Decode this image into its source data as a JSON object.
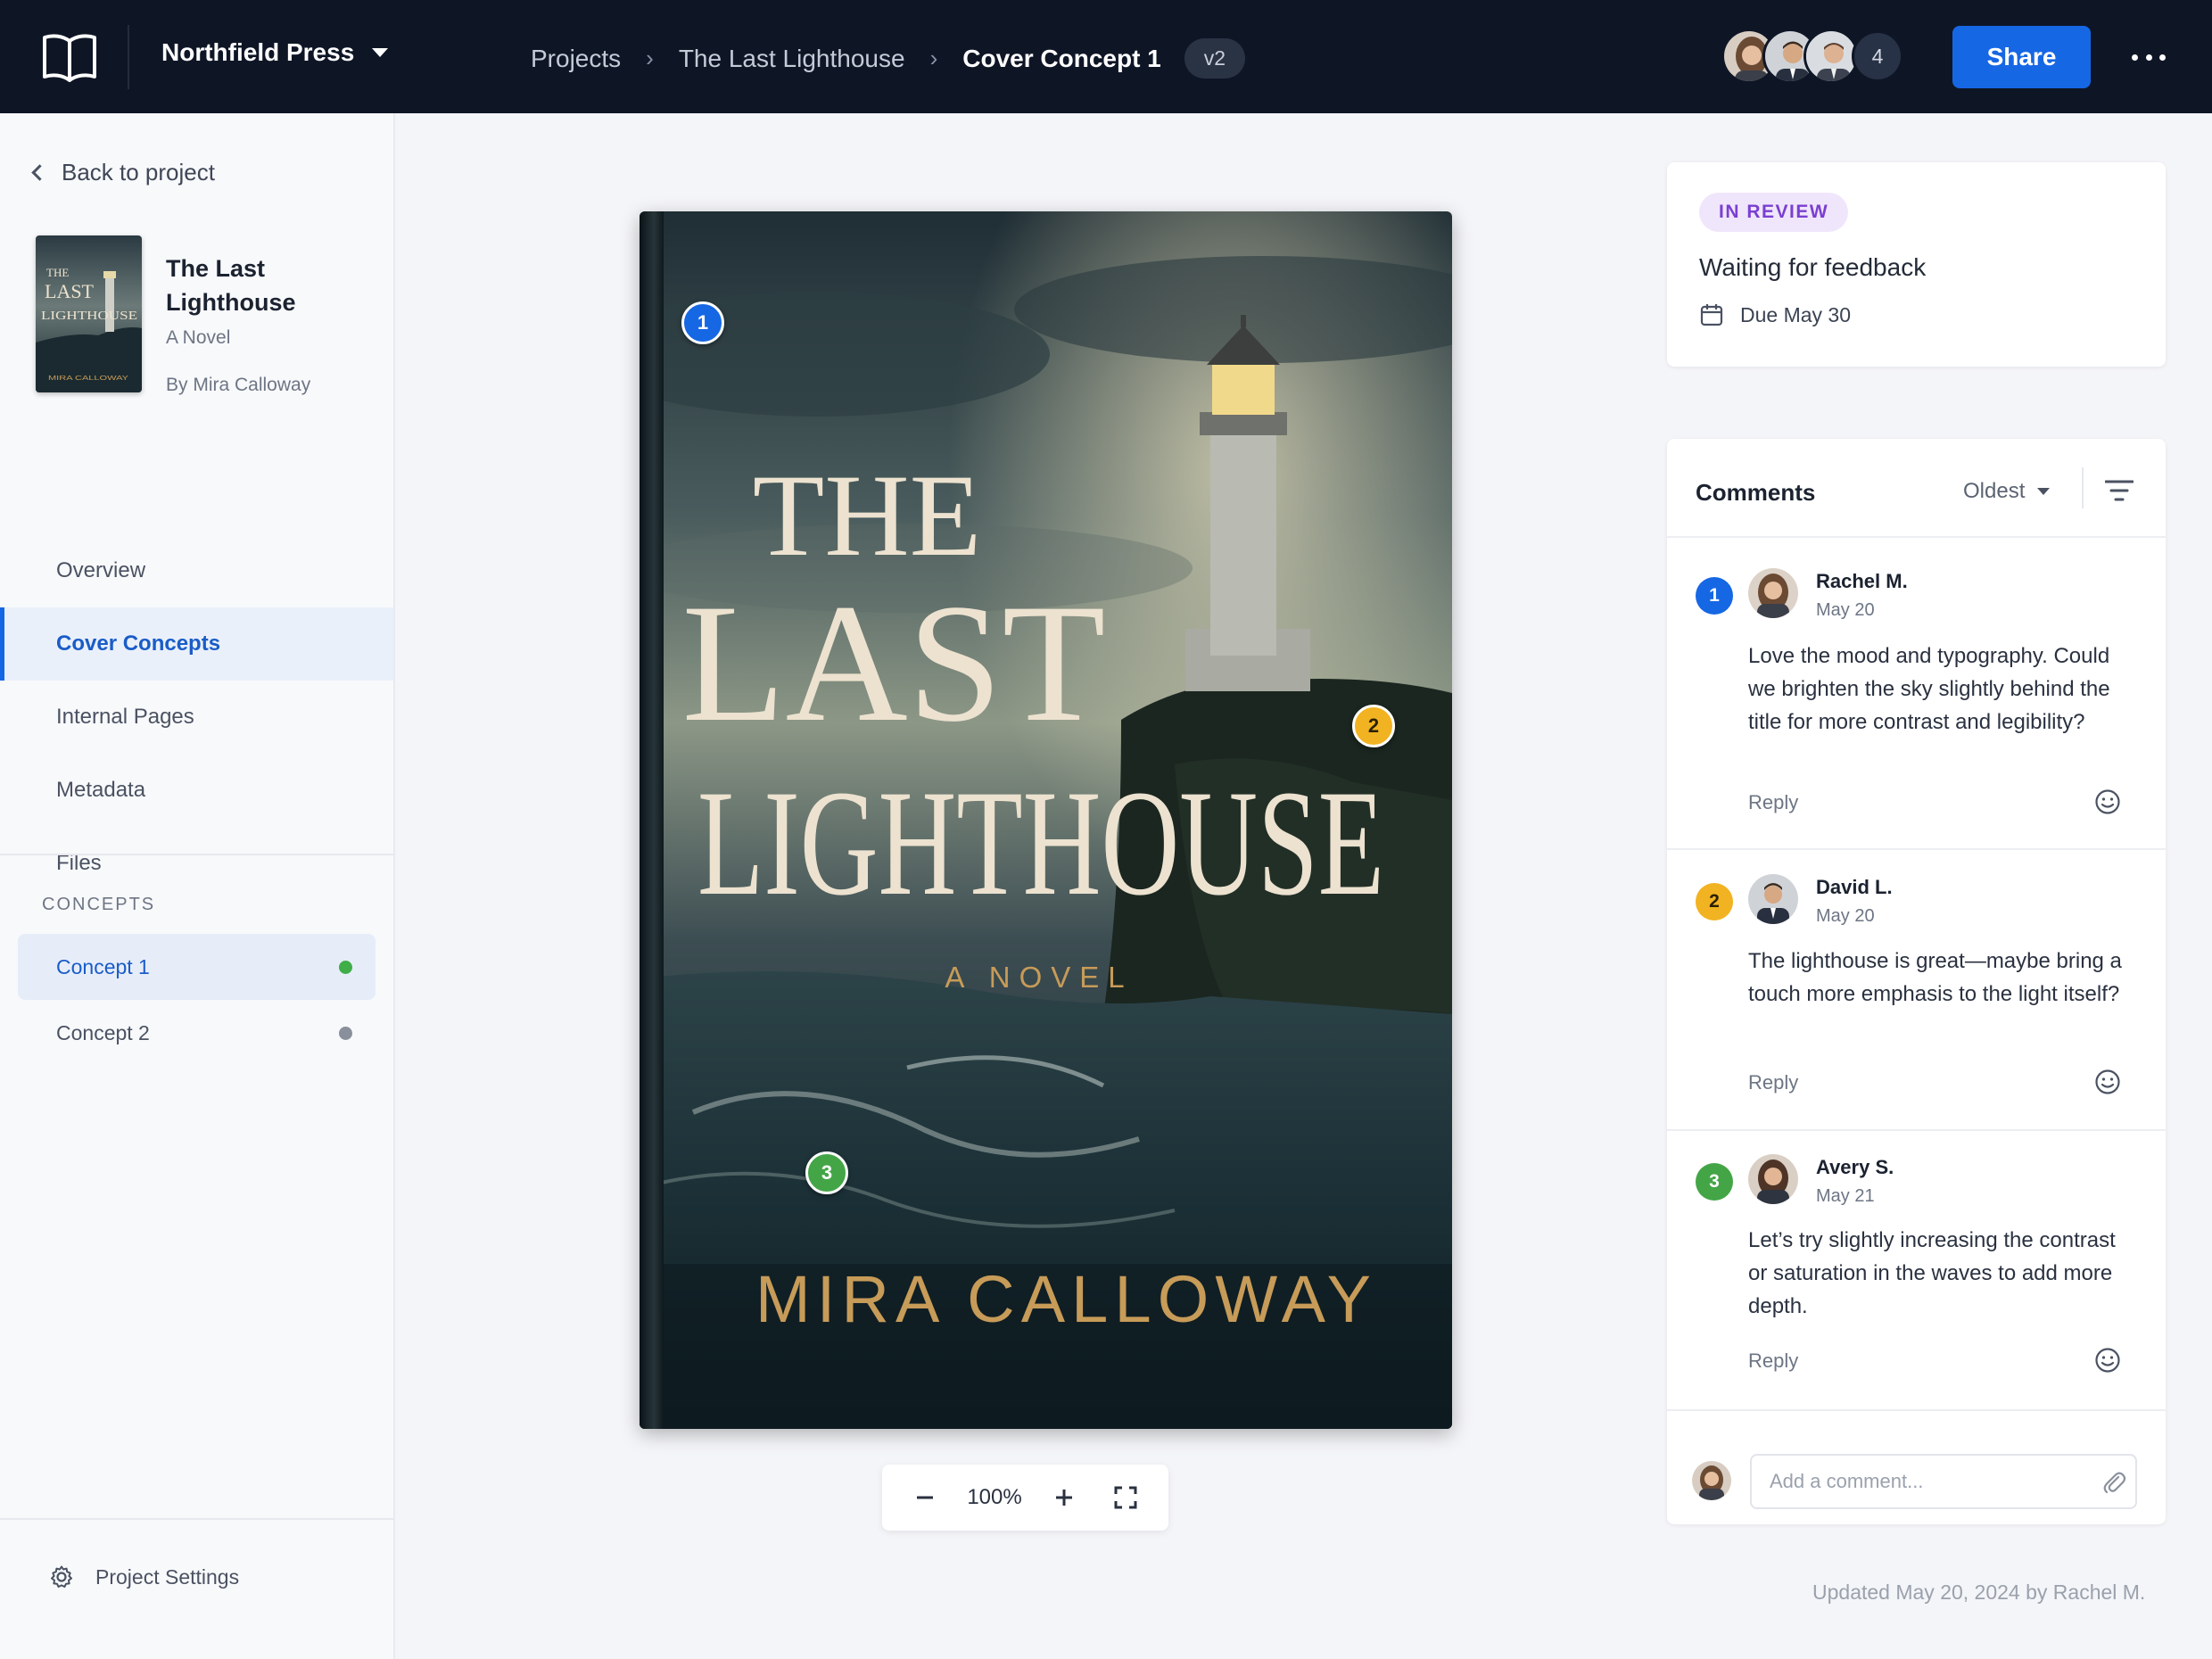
{
  "topbar": {
    "org_name": "Northfield Press",
    "breadcrumbs": [
      "Projects",
      "The Last Lighthouse",
      "Cover Concept 1"
    ],
    "version": "v2",
    "collaborator_extra_count": "4",
    "share_label": "Share"
  },
  "sidebar": {
    "back_label": "Back to project",
    "project": {
      "title": "The Last Lighthouse",
      "subtitle": "A Novel",
      "author": "By Mira Calloway",
      "thumb_title_line1": "THE",
      "thumb_title_line2": "LAST",
      "thumb_title_line3": "LIGHTHOUSE",
      "thumb_author": "MIRA CALLOWAY"
    },
    "nav": [
      {
        "label": "Overview",
        "active": false
      },
      {
        "label": "Cover Concepts",
        "active": true
      },
      {
        "label": "Internal Pages",
        "active": false
      },
      {
        "label": "Metadata",
        "active": false
      },
      {
        "label": "Files",
        "active": false
      }
    ],
    "concepts_heading": "CONCEPTS",
    "concepts": [
      {
        "label": "Concept 1",
        "active": true,
        "status_color": "#3fae49"
      },
      {
        "label": "Concept 2",
        "active": false,
        "status_color": "#8a909b"
      }
    ],
    "settings_label": "Project Settings"
  },
  "cover": {
    "title_line1": "THE",
    "title_line2": "LAST",
    "title_line3": "LIGHTHOUSE",
    "subtitle": "A NOVEL",
    "author": "MIRA CALLOWAY",
    "pins": [
      {
        "number": "1",
        "color": "#1667e4"
      },
      {
        "number": "2",
        "color": "#f2b322"
      },
      {
        "number": "3",
        "color": "#44a546"
      }
    ]
  },
  "zoom": {
    "value": "100%"
  },
  "review": {
    "badge": "IN REVIEW",
    "status": "Waiting for feedback",
    "due": "Due May 30"
  },
  "comments": {
    "title": "Comments",
    "sort_label": "Oldest",
    "items": [
      {
        "number": "1",
        "number_color": "#1667e4",
        "author": "Rachel M.",
        "date": "May 20",
        "text": "Love the mood and typography. Could we brighten the sky slightly behind the title for more contrast and legibility?",
        "reply_label": "Reply"
      },
      {
        "number": "2",
        "number_color": "#f2b322",
        "author": "David L.",
        "date": "May 20",
        "text": "The lighthouse is great—maybe bring a touch more emphasis to the light itself?",
        "reply_label": "Reply"
      },
      {
        "number": "3",
        "number_color": "#44a546",
        "author": "Avery S.",
        "date": "May 21",
        "text": "Let’s try slightly increasing the contrast or saturation in the waves to add more depth.",
        "reply_label": "Reply"
      }
    ],
    "input_placeholder": "Add a comment..."
  },
  "footer": {
    "updated": "Updated May 20, 2024 by Rachel M."
  },
  "colors": {
    "topbar": "#0e1626",
    "accent": "#1667e4",
    "review_badge_bg": "#f0e6fb",
    "review_badge_text": "#7a3fd1",
    "cover_title": "#ece2cf",
    "cover_author": "#c79b58"
  }
}
